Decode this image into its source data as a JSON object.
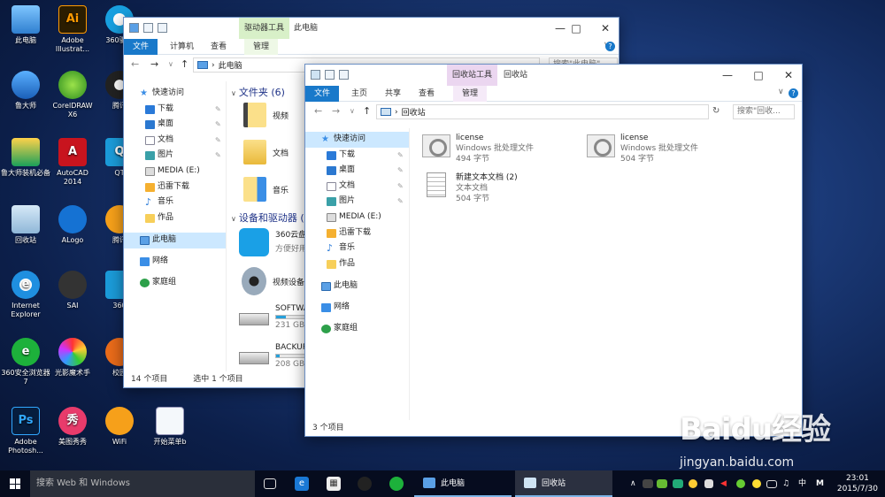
{
  "desktop": {
    "icons": [
      {
        "label": "此电脑",
        "icon": "computer-icon",
        "color": "#2f7fd0"
      },
      {
        "label": "Adobe Illustrat...",
        "icon": "illustrator-icon",
        "color": "#ff9a00",
        "glyph": "Ai"
      },
      {
        "label": "360驱动",
        "icon": "360-driver-icon",
        "color": "#18a0e0"
      },
      {
        "label": "鲁大师",
        "icon": "ludashi-icon",
        "color": "#1a5fb8"
      },
      {
        "label": "CorelDRAW X6",
        "icon": "coreldraw-icon",
        "color": "#2a8a1e"
      },
      {
        "label": "腾讯",
        "icon": "tencent-qq-icon",
        "color": "#222222"
      },
      {
        "label": "鲁大师装机必备",
        "icon": "ludashi-installer-icon",
        "color": "#1aa05a"
      },
      {
        "label": "AutoCAD 2014",
        "icon": "autocad-icon",
        "color": "#c8141e",
        "glyph": "A"
      },
      {
        "label": "QT",
        "icon": "qt-icon",
        "color": "#1b9bd9",
        "glyph": "Q"
      },
      {
        "label": "回收站",
        "icon": "recycle-bin-icon",
        "color": "#8fb7d8"
      },
      {
        "label": "ALogo",
        "icon": "alogo-icon",
        "color": "#1572d3"
      },
      {
        "label": "腾讯",
        "icon": "tencent-app-icon",
        "color": "#f6a01a"
      },
      {
        "label": "Internet Explorer",
        "icon": "internet-explorer-icon",
        "color": "#1f8fe0",
        "glyph": "e"
      },
      {
        "label": "SAI",
        "icon": "sai-icon",
        "color": "#333333"
      },
      {
        "label": "360",
        "icon": "360-cloud-icon",
        "color": "#1b9bd9"
      },
      {
        "label": "360安全浏览器7",
        "icon": "360-browser-icon",
        "color": "#1db13b",
        "glyph": "e"
      },
      {
        "label": "光影魔术手",
        "icon": "guangying-icon",
        "color": "#f3a"
      },
      {
        "label": "校园",
        "icon": "campus-icon",
        "color": "#e96b1a"
      },
      {
        "label": "Adobe Photosh...",
        "icon": "photoshop-icon",
        "color": "#31a8ff",
        "glyph": "Ps"
      },
      {
        "label": "美图秀秀",
        "icon": "meitu-icon",
        "color": "#e83b6b",
        "glyph": "秀"
      },
      {
        "label": "WiFi",
        "icon": "wifi-icon",
        "color": "#f6a01a"
      },
      {
        "label": "开始菜单b",
        "icon": "start-menu-image-icon",
        "color": "#4a8fd8"
      }
    ]
  },
  "main_window": {
    "title": "此电脑",
    "context_tab": "驱动器工具",
    "ribbon_tabs": [
      "文件",
      "计算机",
      "查看",
      "管理"
    ],
    "address": "此电脑",
    "search_placeholder": "搜索\"此电脑\"",
    "nav": [
      {
        "label": "快速访问",
        "icon": "star-icon",
        "pinned": false
      },
      {
        "label": "下载",
        "icon": "download-folder-icon",
        "pinned": true
      },
      {
        "label": "桌面",
        "icon": "desktop-folder-icon",
        "pinned": true
      },
      {
        "label": "文档",
        "icon": "documents-folder-icon",
        "pinned": true
      },
      {
        "label": "图片",
        "icon": "pictures-folder-icon",
        "pinned": true
      },
      {
        "label": "MEDIA (E:)",
        "icon": "drive-icon",
        "pinned": false
      },
      {
        "label": "迅雷下载",
        "icon": "xunlei-folder-icon",
        "pinned": false
      },
      {
        "label": "音乐",
        "icon": "music-icon",
        "pinned": false
      },
      {
        "label": "作品",
        "icon": "folder-icon",
        "pinned": false
      },
      {
        "label": "此电脑",
        "icon": "this-pc-icon",
        "pinned": false,
        "selected": true
      },
      {
        "label": "网络",
        "icon": "network-icon",
        "pinned": false
      },
      {
        "label": "家庭组",
        "icon": "homegroup-icon",
        "pinned": false
      }
    ],
    "folders_header": "文件夹 (6)",
    "folders": [
      "视频",
      "文档",
      "音乐"
    ],
    "devices_header": "设备和驱动器 (",
    "devices": [
      {
        "name": "360云盘",
        "sub": "方便好用",
        "icon": "360-cloud-drive-icon"
      },
      {
        "name": "视频设备",
        "sub": "",
        "icon": "webcam-icon"
      },
      {
        "name": "SOFTWA",
        "sub": "231 GB",
        "fill": 0.3,
        "icon": "hard-drive-icon"
      },
      {
        "name": "BACKUP",
        "sub": "208 GB",
        "fill": 0.12,
        "icon": "hard-drive-icon"
      }
    ],
    "status_count": "14 个项目",
    "status_selected": "选中 1 个项目"
  },
  "recycle_window": {
    "title": "回收站",
    "context_tab": "回收站工具",
    "ribbon_tabs": [
      "文件",
      "主页",
      "共享",
      "查看",
      "管理"
    ],
    "address": "回收站",
    "search_placeholder": "搜索\"回收...",
    "nav": [
      {
        "label": "快速访问",
        "icon": "star-icon",
        "pinned": false,
        "selected": true
      },
      {
        "label": "下载",
        "icon": "download-folder-icon",
        "pinned": true
      },
      {
        "label": "桌面",
        "icon": "desktop-folder-icon",
        "pinned": true
      },
      {
        "label": "文档",
        "icon": "documents-folder-icon",
        "pinned": true
      },
      {
        "label": "图片",
        "icon": "pictures-folder-icon",
        "pinned": true
      },
      {
        "label": "MEDIA (E:)",
        "icon": "drive-icon",
        "pinned": false
      },
      {
        "label": "迅雷下载",
        "icon": "xunlei-folder-icon",
        "pinned": false
      },
      {
        "label": "音乐",
        "icon": "music-icon",
        "pinned": false
      },
      {
        "label": "作品",
        "icon": "folder-icon",
        "pinned": false
      },
      {
        "label": "此电脑",
        "icon": "this-pc-icon",
        "pinned": false
      },
      {
        "label": "网络",
        "icon": "network-icon",
        "pinned": false
      },
      {
        "label": "家庭组",
        "icon": "homegroup-icon",
        "pinned": false
      }
    ],
    "items": [
      {
        "name": "license",
        "type": "Windows 批处理文件",
        "size": "494 字节",
        "icon": "batch-file-icon"
      },
      {
        "name": "license",
        "type": "Windows 批处理文件",
        "size": "504 字节",
        "icon": "batch-file-icon"
      },
      {
        "name": "新建文本文档 (2)",
        "type": "文本文档",
        "size": "504 字节",
        "icon": "text-document-icon"
      }
    ],
    "status_count": "3 个项目"
  },
  "taskbar": {
    "search_placeholder": "搜索 Web 和 Windows",
    "tasks": [
      {
        "label": "此电脑",
        "icon": "explorer-icon"
      },
      {
        "label": "回收站",
        "icon": "recycle-bin-icon"
      }
    ],
    "ime": "中",
    "time": "23:01",
    "date": "2015/7/30"
  },
  "watermark": {
    "logo": "Baidu经验",
    "url": "jingyan.baidu.com"
  }
}
